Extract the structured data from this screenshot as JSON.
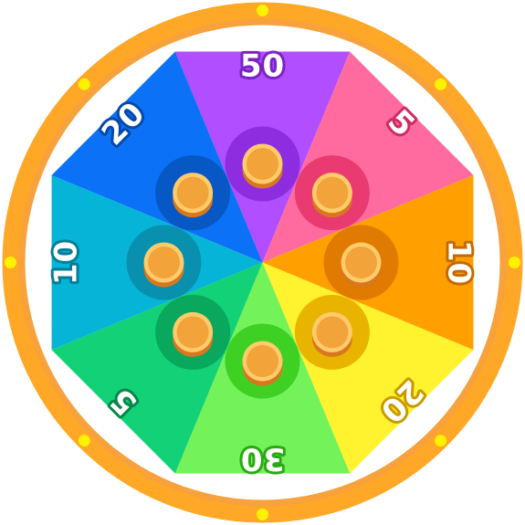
{
  "wheel": {
    "rim_color": "#FFA726",
    "rim_inner_color": "#F7A23C",
    "separator_color": "#FFFFFF",
    "bulb_color": "#FFF200",
    "bulb_count": 8,
    "coin_colors": {
      "face": "#F2A33A",
      "rim": "#FFCB6B",
      "edge": "#D9771F"
    },
    "segments": [
      {
        "label": "50",
        "color": "#B14EFF",
        "ring_color": "#8E2DE0",
        "outline": "#7A22C7"
      },
      {
        "label": "5",
        "color": "#FF6B9E",
        "ring_color": "#E93B72",
        "outline": "#D12A62"
      },
      {
        "label": "10",
        "color": "#FF9F00",
        "ring_color": "#E17A00",
        "outline": "#C46A00"
      },
      {
        "label": "20",
        "color": "#FFF22E",
        "ring_color": "#E8B400",
        "outline": "#C99A00"
      },
      {
        "label": "30",
        "color": "#74F25A",
        "ring_color": "#3FD024",
        "outline": "#2BA915"
      },
      {
        "label": "5",
        "color": "#12D177",
        "ring_color": "#09A85C",
        "outline": "#07874A"
      },
      {
        "label": "10",
        "color": "#06B4D8",
        "ring_color": "#0990AE",
        "outline": "#067C96"
      },
      {
        "label": "20",
        "color": "#0B72F7",
        "ring_color": "#0757C4",
        "outline": "#0649A8"
      }
    ]
  }
}
